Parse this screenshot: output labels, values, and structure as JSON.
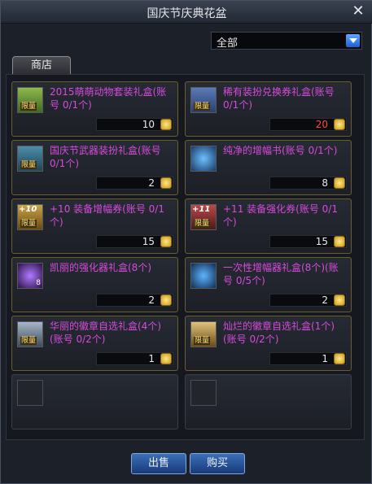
{
  "window": {
    "title": "国庆节庆典花盆"
  },
  "filter": {
    "value": "全部"
  },
  "tabs": [
    {
      "label": "商店"
    }
  ],
  "items": [
    {
      "name": "2015萌萌动物套装礼盒(账号 0/1个)",
      "qty": "10",
      "qty_color": "#e8e8e8",
      "icon": "animal-outfit-box-icon"
    },
    {
      "name": "稀有装扮兑换券礼盒(账号 0/1个)",
      "qty": "20",
      "qty_color": "#ff4a3a",
      "icon": "rare-costume-ticket-icon"
    },
    {
      "name": "国庆节武器装扮礼盒(账号 0/1个)",
      "qty": "2",
      "qty_color": "#e8e8e8",
      "icon": "weapon-costume-box-icon"
    },
    {
      "name": "纯净的增幅书(账号 0/1个)",
      "qty": "8",
      "qty_color": "#e8e8e8",
      "icon": "amplify-book-icon"
    },
    {
      "name": "+10 装备增幅券(账号 0/1个)",
      "qty": "15",
      "qty_color": "#e8e8e8",
      "icon": "amplify-ticket-icon",
      "plus": "+10"
    },
    {
      "name": "+11 装备强化券(账号 0/1个)",
      "qty": "15",
      "qty_color": "#e8e8e8",
      "icon": "enhance-ticket-icon",
      "plus": "+11"
    },
    {
      "name": "凯丽的强化器礼盒(8个)",
      "qty": "2",
      "qty_color": "#e8e8e8",
      "icon": "kiri-enhancer-box-icon",
      "count": "8"
    },
    {
      "name": "一次性增幅器礼盒(8个)(账号 0/5个)",
      "qty": "2",
      "qty_color": "#e8e8e8",
      "icon": "amplifier-box-icon"
    },
    {
      "name": "华丽的徽章自选礼盒(4个)(账号 0/2个)",
      "qty": "1",
      "qty_color": "#e8e8e8",
      "icon": "emblem-box-icon"
    },
    {
      "name": "灿烂的徽章自选礼盒(1个)(账号 0/2个)",
      "qty": "1",
      "qty_color": "#e8e8e8",
      "icon": "brilliant-emblem-box-icon"
    }
  ],
  "limit_label": "限量",
  "buttons": {
    "sell": "出售",
    "buy": "购买"
  },
  "colors": {
    "item_name": "#d64bdc",
    "accent": "#2f6ad8"
  }
}
